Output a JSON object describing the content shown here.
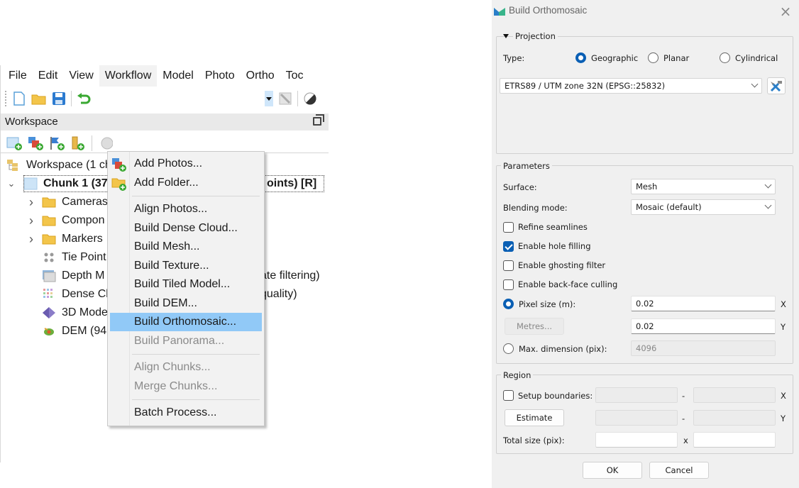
{
  "app": {
    "menubar": [
      "File",
      "Edit",
      "View",
      "Workflow",
      "Model",
      "Photo",
      "Ortho",
      "Toc"
    ],
    "open_menu": "Workflow",
    "workspace_panel_title": "Workspace",
    "tree": {
      "root": "Workspace (1 ch",
      "chunk": "Chunk 1 (37",
      "chunk_tail": "oints) [R]",
      "items": [
        {
          "label": "Cameras",
          "icon": "folder-icon",
          "expandable": true,
          "tail": ""
        },
        {
          "label": "Compon",
          "icon": "folder-icon",
          "expandable": true,
          "tail": ""
        },
        {
          "label": "Markers",
          "icon": "folder-icon",
          "expandable": true,
          "tail": ""
        },
        {
          "label": "Tie Point",
          "icon": "tie-points-icon",
          "expandable": false,
          "tail": ""
        },
        {
          "label": "Depth M",
          "icon": "depth-maps-icon",
          "expandable": false,
          "tail": "ate filtering)"
        },
        {
          "label": "Dense Cl",
          "icon": "dense-cloud-icon",
          "expandable": false,
          "tail": "quality)"
        },
        {
          "label": "3D Mode",
          "icon": "3d-model-icon",
          "expandable": false,
          "tail": ")"
        },
        {
          "label": "DEM (94",
          "icon": "dem-icon",
          "expandable": false,
          "tail": ""
        }
      ]
    },
    "workflow_menu": [
      {
        "label": "Add Photos...",
        "icon": "add-photos-icon",
        "enabled": true,
        "highlighted": false
      },
      {
        "label": "Add Folder...",
        "icon": "add-folder-icon",
        "enabled": true,
        "highlighted": false
      },
      {
        "separator": true
      },
      {
        "label": "Align Photos...",
        "enabled": true,
        "highlighted": false
      },
      {
        "label": "Build Dense Cloud...",
        "enabled": true,
        "highlighted": false
      },
      {
        "label": "Build Mesh...",
        "enabled": true,
        "highlighted": false
      },
      {
        "label": "Build Texture...",
        "enabled": true,
        "highlighted": false
      },
      {
        "label": "Build Tiled Model...",
        "enabled": true,
        "highlighted": false
      },
      {
        "label": "Build DEM...",
        "enabled": true,
        "highlighted": false
      },
      {
        "label": "Build Orthomosaic...",
        "enabled": true,
        "highlighted": true
      },
      {
        "label": "Build Panorama...",
        "enabled": false,
        "highlighted": false
      },
      {
        "separator": true
      },
      {
        "label": "Align Chunks...",
        "enabled": false,
        "highlighted": false
      },
      {
        "label": "Merge Chunks...",
        "enabled": false,
        "highlighted": false
      },
      {
        "separator": true
      },
      {
        "label": "Batch Process...",
        "enabled": true,
        "highlighted": false
      }
    ],
    "colors": {
      "highlight": "#91c9f7",
      "menu_bg": "#f2f2f2"
    }
  },
  "dialog": {
    "title": "Build Orthomosaic",
    "close": "×",
    "projection": {
      "group_label": "Projection",
      "type_label": "Type:",
      "types": [
        "Geographic",
        "Planar",
        "Cylindrical"
      ],
      "selected_type": "Geographic",
      "crs": "ETRS89 / UTM zone 32N (EPSG::25832)"
    },
    "parameters": {
      "group_label": "Parameters",
      "surface_label": "Surface:",
      "surface_value": "Mesh",
      "blending_label": "Blending mode:",
      "blending_value": "Mosaic (default)",
      "checkboxes": [
        {
          "label": "Refine seamlines",
          "checked": false
        },
        {
          "label": "Enable hole filling",
          "checked": true
        },
        {
          "label": "Enable ghosting filter",
          "checked": false
        },
        {
          "label": "Enable back-face culling",
          "checked": false
        }
      ],
      "pixel_size_label": "Pixel size (m):",
      "pixel_size_selected": true,
      "pixel_x": "0.02",
      "pixel_y": "0.02",
      "x_axis": "X",
      "y_axis": "Y",
      "metres_button": "Metres...",
      "max_dim_label": "Max. dimension (pix):",
      "max_dim_selected": false,
      "max_dim_value": "4096"
    },
    "region": {
      "group_label": "Region",
      "setup_label": "Setup boundaries:",
      "setup_checked": false,
      "dash": "-",
      "x_axis": "X",
      "y_axis": "Y",
      "estimate_button": "Estimate",
      "total_label": "Total size (pix):",
      "times": "x",
      "total_w": "",
      "total_h": ""
    },
    "ok_button": "OK",
    "cancel_button": "Cancel",
    "colors": {
      "accent": "#0a5fb4",
      "bg": "#f0f0f0"
    }
  }
}
